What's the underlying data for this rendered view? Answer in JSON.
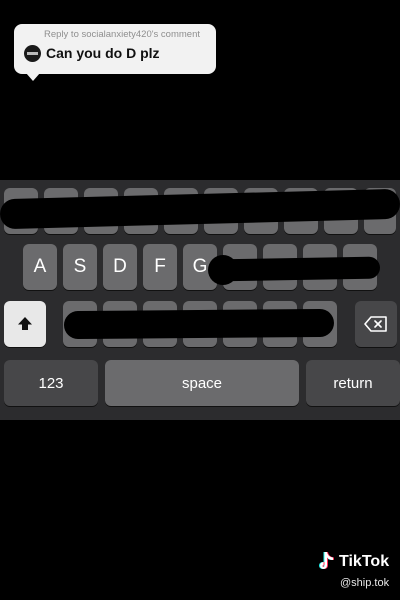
{
  "comment": {
    "reply_label": "Reply to socialanxiety420's comment",
    "text": "Can you do D plz"
  },
  "keyboard": {
    "row1": [
      "",
      "",
      "",
      "",
      "",
      "",
      "",
      "",
      "",
      ""
    ],
    "row2": [
      "A",
      "S",
      "D",
      "F",
      "G",
      "",
      "",
      "",
      ""
    ],
    "row3": [
      "",
      "",
      "",
      "",
      "",
      "",
      ""
    ],
    "numbers_label": "123",
    "space_label": "space",
    "return_label": "return",
    "shift_icon": "shift-up-arrow-icon",
    "backspace_icon": "backspace-icon"
  },
  "watermark": {
    "brand": "TikTok",
    "handle": "@ship.tok",
    "logo_icon": "tiktok-note-icon"
  },
  "colors": {
    "key": "#6b6b6d",
    "function_key": "#474749",
    "keyboard_bg": "#2c2c2e",
    "scribble": "#000000"
  }
}
